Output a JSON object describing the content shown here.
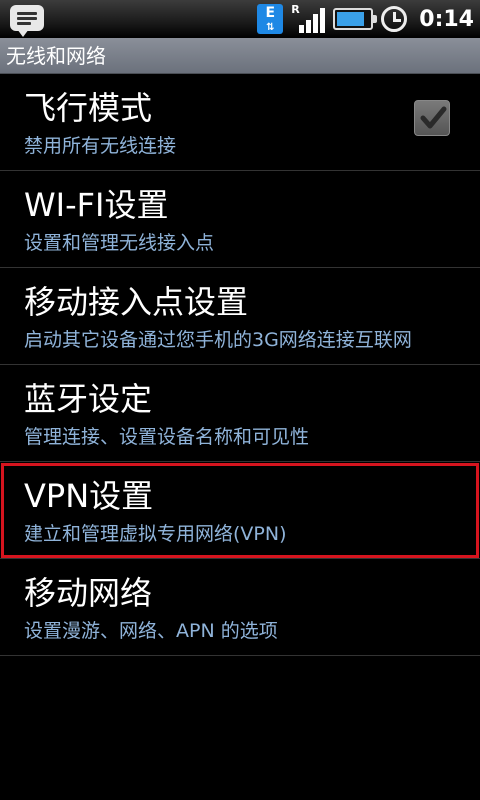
{
  "status_bar": {
    "time": "0:14",
    "network_type": "E",
    "roaming_indicator": "R",
    "battery_level": 0.85,
    "signal_bars": 4,
    "icons": [
      "message-icon",
      "edge-data-icon",
      "signal-icon",
      "battery-icon",
      "alarm-icon"
    ]
  },
  "header": {
    "title": "无线和网络"
  },
  "settings": {
    "items": [
      {
        "title": "飞行模式",
        "summary": "禁用所有无线连接",
        "checkbox": true,
        "checked": true
      },
      {
        "title": "WI-FI设置",
        "summary": "设置和管理无线接入点"
      },
      {
        "title": "移动接入点设置",
        "summary": "启动其它设备通过您手机的3G网络连接互联网"
      },
      {
        "title": "蓝牙设定",
        "summary": "管理连接、设置设备名称和可见性"
      },
      {
        "title": "VPN设置",
        "summary": "建立和管理虚拟专用网络(VPN)",
        "highlighted": true
      },
      {
        "title": "移动网络",
        "summary": "设置漫游、网络、APN 的选项"
      }
    ]
  },
  "colors": {
    "summary_text": "#8fb3d9",
    "highlight_border": "#d6141e",
    "title_bar": "#7a7f89"
  }
}
